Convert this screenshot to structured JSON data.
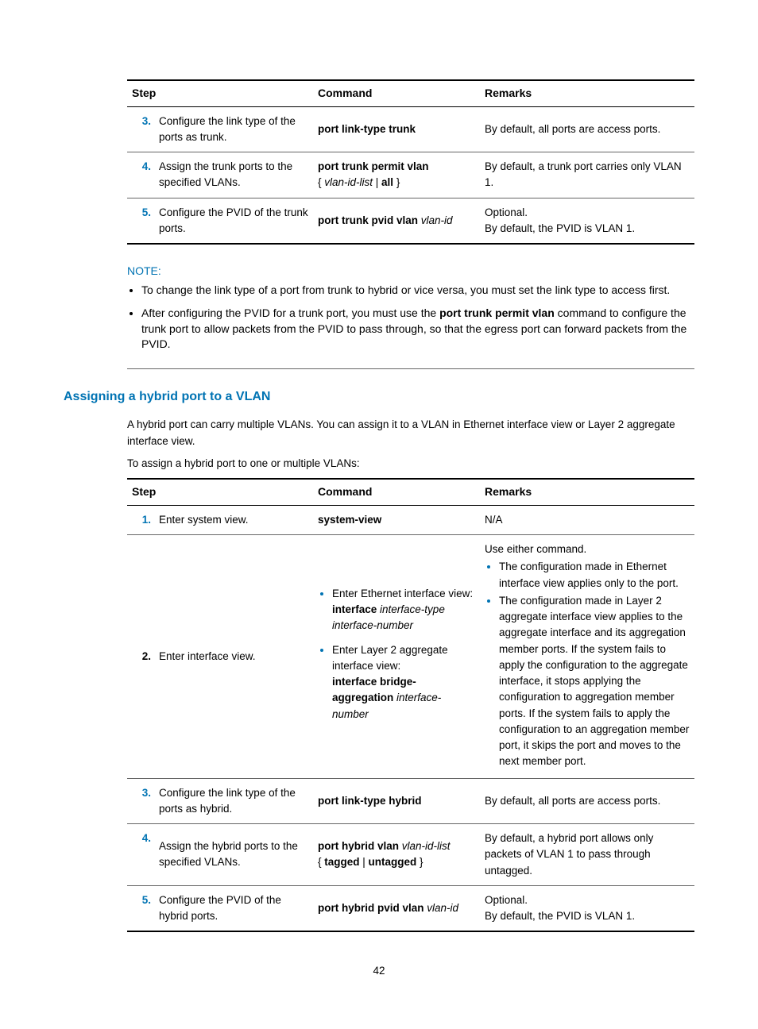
{
  "table1": {
    "headers": {
      "step": "Step",
      "command": "Command",
      "remarks": "Remarks"
    },
    "rows": [
      {
        "num": "3.",
        "desc": "Configure the link type of the ports as trunk.",
        "cmd_bold": "port link-type trunk",
        "remarks": "By default, all ports are access ports."
      },
      {
        "num": "4.",
        "desc": "Assign the trunk ports to the specified VLANs.",
        "cmd_bold": "port trunk permit vlan",
        "cmd_brace_open": "{ ",
        "cmd_italic": "vlan-id-list",
        "cmd_sep": " | ",
        "cmd_all": "all",
        "cmd_brace_close": " }",
        "remarks": "By default, a trunk port carries only VLAN 1."
      },
      {
        "num": "5.",
        "desc": "Configure the PVID of the trunk ports.",
        "cmd_bold": "port trunk pvid vlan ",
        "cmd_italic": "vlan-id",
        "remarks_line1": "Optional.",
        "remarks_line2": "By default, the PVID is VLAN 1."
      }
    ]
  },
  "note": {
    "title": "NOTE:",
    "items": [
      "To change the link type of a port from trunk to hybrid or vice versa, you must set the link type to access first.",
      {
        "pre": "After configuring the PVID for a trunk port, you must use the ",
        "bold": "port trunk permit vlan",
        "post": " command to configure the trunk port to allow packets from the PVID to pass through, so that the egress port can forward packets from the PVID."
      }
    ]
  },
  "heading": "Assigning a hybrid port to a VLAN",
  "para1": "A hybrid port can carry multiple VLANs. You can assign it to a VLAN in Ethernet interface view or Layer 2 aggregate interface view.",
  "para2": "To assign a hybrid port to one or multiple VLANs:",
  "table2": {
    "headers": {
      "step": "Step",
      "command": "Command",
      "remarks": "Remarks"
    },
    "rows": {
      "r1": {
        "num": "1.",
        "desc": "Enter system view.",
        "cmd_bold": "system-view",
        "remarks": "N/A"
      },
      "r2": {
        "num": "2.",
        "desc": "Enter interface view.",
        "cmd_item1_pre": "Enter Ethernet interface view:",
        "cmd_item1_bold": "interface",
        "cmd_item1_italic": " interface-type interface-number",
        "cmd_item2_pre": "Enter Layer 2 aggregate interface view:",
        "cmd_item2_bold": "interface bridge-aggregation",
        "cmd_item2_italic": " interface-number",
        "remarks_intro": "Use either command.",
        "remarks_b1": "The configuration made in Ethernet interface view applies only to the port.",
        "remarks_b2": "The configuration made in Layer 2 aggregate interface view applies to the aggregate interface and its aggregation member ports. If the system fails to apply the configuration to the aggregate interface, it stops applying the configuration to aggregation member ports. If the system fails to apply the configuration to an aggregation member port, it skips the port and moves to the next member port."
      },
      "r3": {
        "num": "3.",
        "desc": "Configure the link type of the ports as hybrid.",
        "cmd_bold": "port link-type hybrid",
        "remarks": "By default, all ports are access ports."
      },
      "r4": {
        "num": "4.",
        "desc": "Assign the hybrid ports to the specified VLANs.",
        "cmd_bold": "port hybrid vlan ",
        "cmd_italic": "vlan-id-list",
        "cmd_line2_open": "{ ",
        "cmd_line2_tagged": "tagged",
        "cmd_line2_sep": " | ",
        "cmd_line2_untagged": "untagged",
        "cmd_line2_close": " }",
        "remarks": "By default, a hybrid port allows only packets of VLAN 1 to pass through untagged."
      },
      "r5": {
        "num": "5.",
        "desc": "Configure the PVID of the hybrid ports.",
        "cmd_bold": "port hybrid pvid vlan ",
        "cmd_italic": "vlan-id",
        "remarks_line1": "Optional.",
        "remarks_line2": "By default, the PVID is VLAN 1."
      }
    }
  },
  "page_number": "42"
}
